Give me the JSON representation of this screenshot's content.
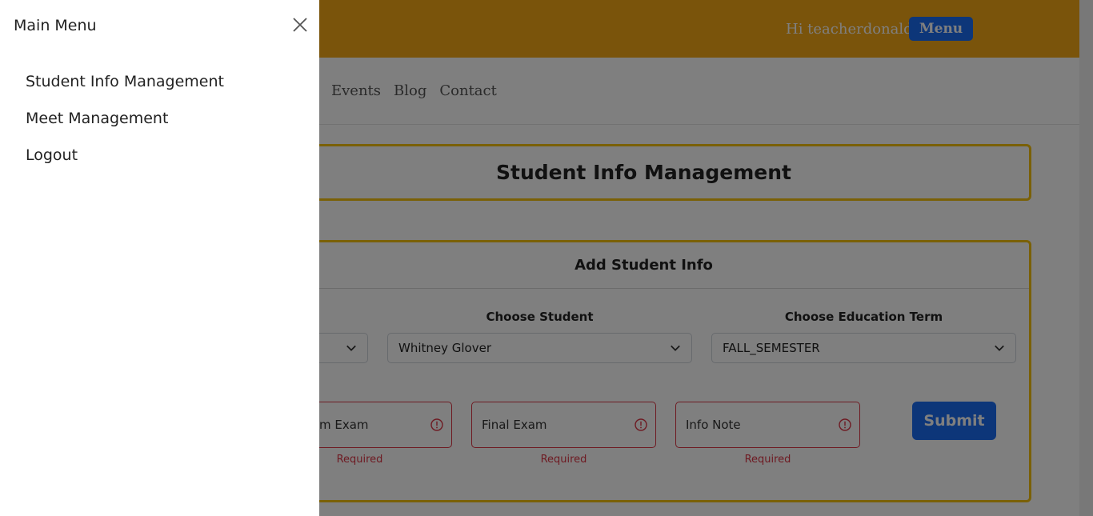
{
  "header": {
    "greeting": "Hi teacherdonald",
    "menu_label": "Menu"
  },
  "nav": {
    "links": [
      "Events",
      "Blog",
      "Contact"
    ]
  },
  "page_title": "Student Info Management",
  "form": {
    "title": "Add Student Info",
    "student_label": "Choose Student",
    "student_value": "Whitney Glover",
    "term_label": "Choose Education Term",
    "term_value": "FALL_SEMESTER",
    "midterm_placeholder": "m Exam",
    "final_placeholder": "Final Exam",
    "note_placeholder": "Info Note",
    "required_text": "Required",
    "submit_label": "Submit"
  },
  "drawer": {
    "title": "Main Menu",
    "items": [
      "Student Info Management",
      "Meet Management",
      "Logout"
    ]
  },
  "colors": {
    "header_bg": "#f4a817",
    "primary": "#1b6cf2",
    "card_border": "#f4c10f",
    "error": "#dc3545"
  }
}
